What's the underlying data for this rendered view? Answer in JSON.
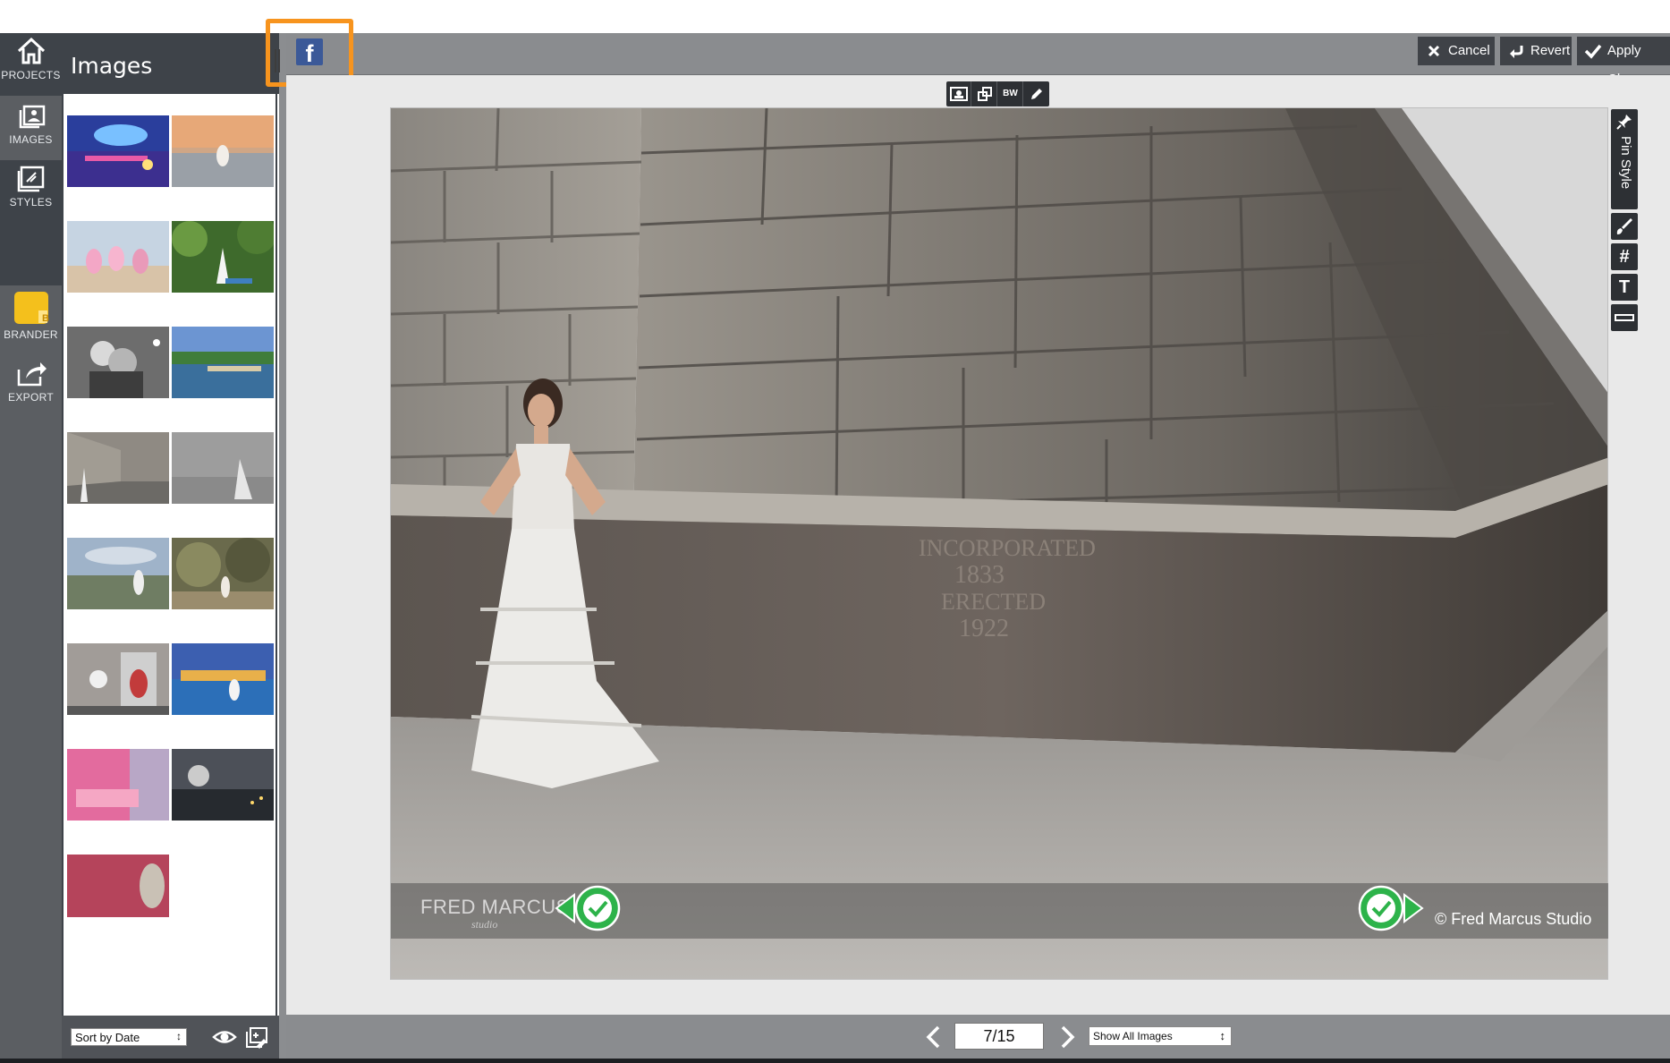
{
  "rail": {
    "items": [
      {
        "label": "PROJECTS",
        "icon": "home-icon"
      },
      {
        "label": "IMAGES",
        "icon": "images-icon"
      },
      {
        "label": "STYLES",
        "icon": "styles-icon"
      },
      {
        "label": "BRANDER",
        "icon": "brander-icon"
      },
      {
        "label": "EXPORT",
        "icon": "export-icon"
      }
    ]
  },
  "panel": {
    "title": "Images",
    "sort_label": "Sort by Date"
  },
  "toolbar": {
    "cancel_label": "Cancel",
    "revert_label": "Revert",
    "apply_label": "Apply Chan",
    "share_icon": "facebook-icon",
    "highlight_color": "#f7941e"
  },
  "view_tools": {
    "bw_label": "BW"
  },
  "side_tools": {
    "pin_style_label": "Pin Style",
    "hash_label": "#",
    "text_label": "T"
  },
  "photo": {
    "watermark_left": "FRED MARCUS",
    "watermark_left_sub": "studio",
    "watermark_right": "© Fred Marcus Studio",
    "stone_text": [
      "INCORPORATED",
      "1833",
      "ERECTED",
      "1922"
    ]
  },
  "nav": {
    "page": "7/15",
    "filter_label": "Show All Images"
  },
  "colors": {
    "rail_dark": "#3e4349",
    "rail": "#5b5e62",
    "toolbar": "#8a8c8f",
    "pin_green": "#2db34a"
  }
}
